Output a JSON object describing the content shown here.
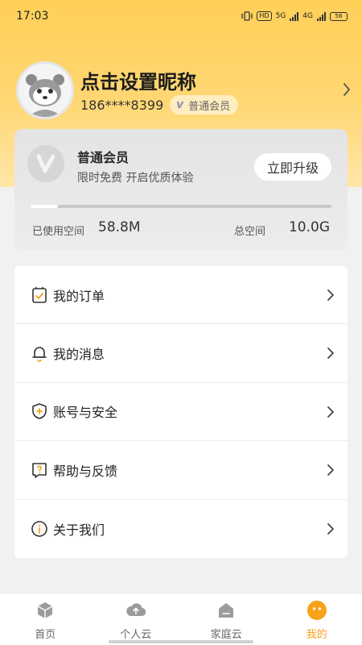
{
  "status_bar": {
    "time": "17:03",
    "hd_label": "HD",
    "net1": "5G",
    "net2": "4G",
    "battery": "56"
  },
  "profile": {
    "nickname": "点击设置昵称",
    "phone": "186****8399",
    "member_badge_letter": "v",
    "member_badge": "普通会员"
  },
  "vip_card": {
    "title": "普通会员",
    "subtitle": "限时免费 开启优质体验",
    "upgrade_label": "立即升级",
    "used_label": "已使用空间",
    "used_value": "58.8M",
    "total_label": "总空间",
    "total_value": "10.0G",
    "usage_fraction": 0.09
  },
  "menu": {
    "items": [
      {
        "label": "我的订单",
        "icon": "order-icon"
      },
      {
        "label": "我的消息",
        "icon": "bell-icon"
      },
      {
        "label": "账号与安全",
        "icon": "shield-icon"
      },
      {
        "label": "帮助与反馈",
        "icon": "help-icon"
      },
      {
        "label": "关于我们",
        "icon": "info-icon"
      }
    ]
  },
  "tabbar": {
    "tabs": [
      {
        "label": "首页",
        "icon": "home-cube-icon"
      },
      {
        "label": "个人云",
        "icon": "cloud-upload-icon"
      },
      {
        "label": "家庭云",
        "icon": "house-icon"
      },
      {
        "label": "我的",
        "icon": "profile-face-icon",
        "active": true
      }
    ]
  },
  "colors": {
    "accent": "#f7a21a",
    "header_yellow": "#ffcf57"
  }
}
